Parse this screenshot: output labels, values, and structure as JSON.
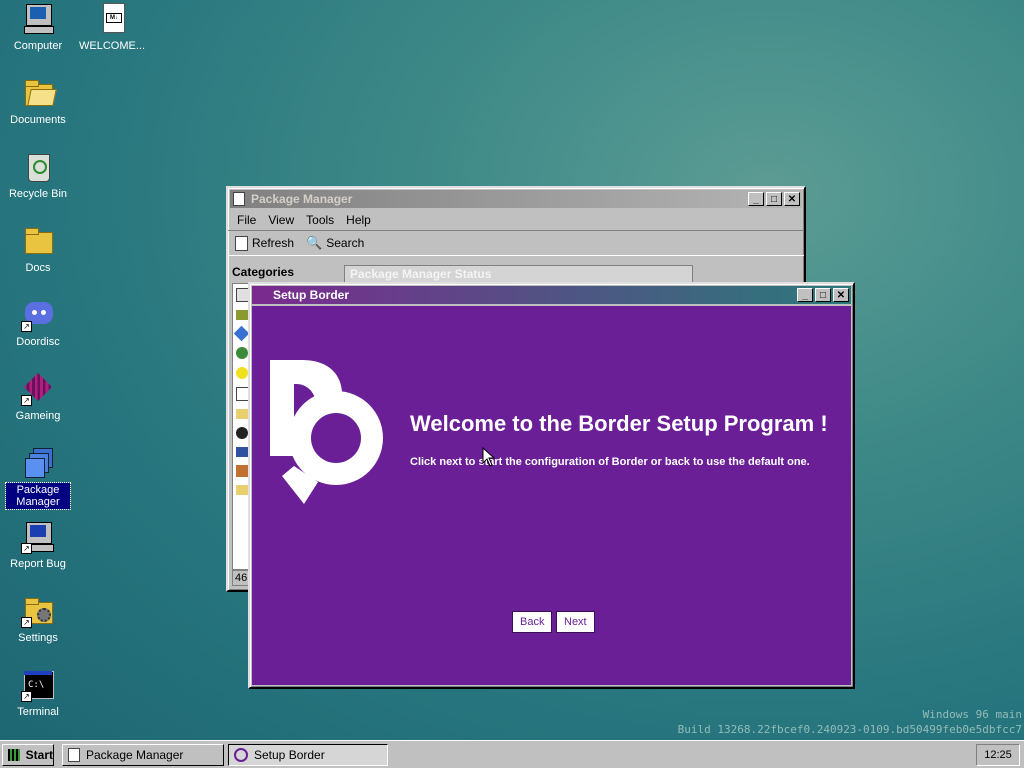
{
  "desktop": {
    "icons": [
      {
        "label": "Computer"
      },
      {
        "label": "WELCOME..."
      },
      {
        "label": "Documents"
      },
      {
        "label": "Recycle Bin"
      },
      {
        "label": "Docs"
      },
      {
        "label": "Doordisc"
      },
      {
        "label": "Gameing"
      },
      {
        "label": "Package Manager"
      },
      {
        "label": "Report Bug"
      },
      {
        "label": "Settings"
      },
      {
        "label": "Terminal"
      }
    ],
    "watermark_line1": "Windows 96 main",
    "watermark_line2": "Build 13268.22fbcef0.240923-0109.bd50499feb0e5dbfcc7"
  },
  "package_manager": {
    "title": "Package Manager",
    "menu": [
      "File",
      "View",
      "Tools",
      "Help"
    ],
    "toolbar": {
      "refresh": "Refresh",
      "search": "Search"
    },
    "categories_label": "Categories",
    "status_panel_title": "Package Manager Status",
    "status_text": "46 p"
  },
  "setup": {
    "title": "Setup Border",
    "heading": "Welcome to the Border Setup Program !",
    "subtext": "Click next to start the configuration of Border or back to use the default one.",
    "back_label": "Back",
    "next_label": "Next",
    "brand_color": "#6a1f97"
  },
  "taskbar": {
    "start_label": "Start",
    "tasks": [
      {
        "label": "Package Manager"
      },
      {
        "label": "Setup Border"
      }
    ],
    "clock": "12:25"
  }
}
